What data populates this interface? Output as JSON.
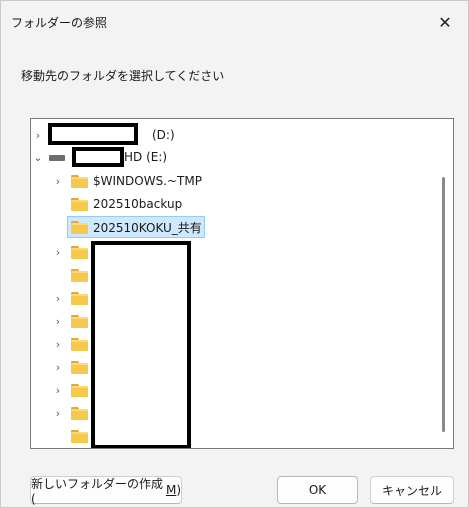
{
  "window": {
    "title": "フォルダーの参照",
    "close_glyph": "✕"
  },
  "instruction": "移動先のフォルダを選択してください",
  "tree": {
    "drive_d_label": "(D:)",
    "drive_e_label": "HD (E:)",
    "items": [
      {
        "label": "$WINDOWS.~TMP",
        "expandable": true
      },
      {
        "label": "202510backup",
        "expandable": false
      },
      {
        "label": "202510KOKU_共有",
        "expandable": false,
        "selected": true
      }
    ],
    "hidden_folder_count_note": ""
  },
  "buttons": {
    "new_folder_prefix": "新しいフォルダーの作成(",
    "new_folder_accel": "M",
    "new_folder_suffix": ")",
    "ok": "OK",
    "cancel": "キャンセル"
  },
  "colors": {
    "selection": "#cde8ff",
    "folder": "#f6c94d"
  }
}
